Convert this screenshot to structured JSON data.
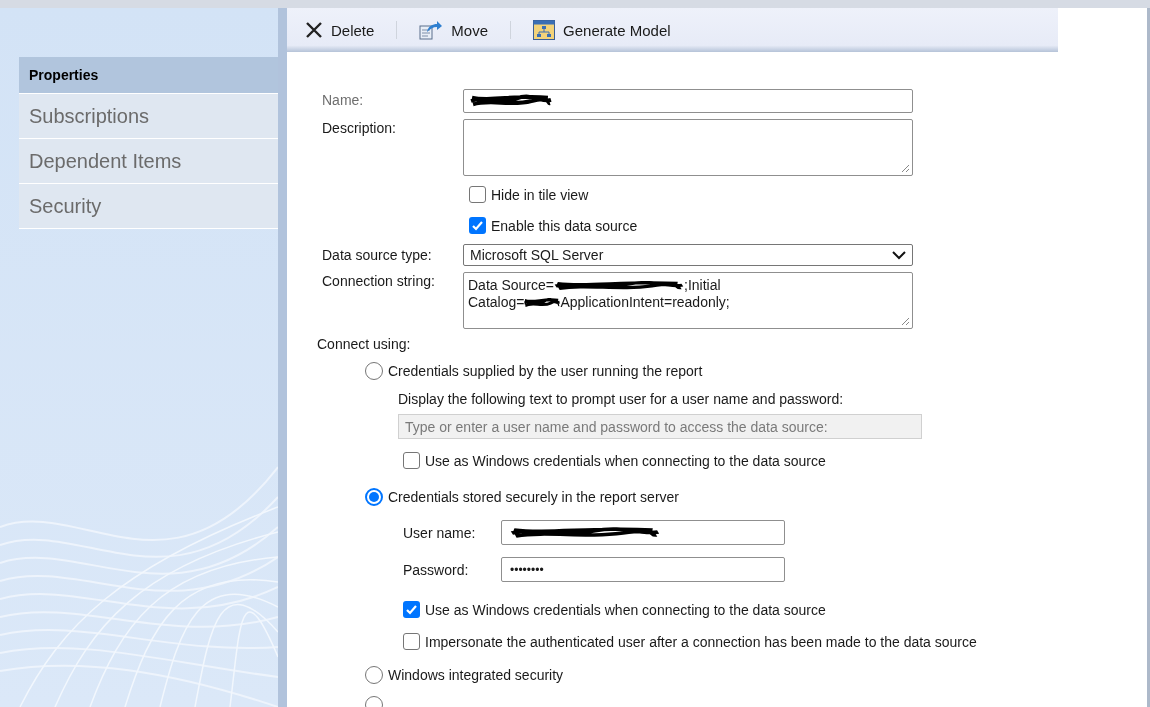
{
  "toolbar": {
    "buttons": [
      {
        "label": "Delete",
        "kind": "delete"
      },
      {
        "label": "Move",
        "kind": "move"
      },
      {
        "label": "Generate Model",
        "kind": "model"
      }
    ]
  },
  "sidebar": {
    "items": [
      {
        "label": "Properties",
        "selected": true
      },
      {
        "label": "Subscriptions",
        "selected": false
      },
      {
        "label": "Dependent Items",
        "selected": false
      },
      {
        "label": "Security",
        "selected": false
      }
    ]
  },
  "form": {
    "name": {
      "label": "Name:",
      "redacted": true
    },
    "description": {
      "label": "Description:"
    },
    "options": [
      {
        "label": "Hide in tile view",
        "checked": false
      },
      {
        "label": "Enable this data source",
        "checked": true
      }
    ],
    "data_source_type": {
      "label": "Data source type:",
      "value": "Microsoft SQL Server"
    },
    "connection_string": {
      "label": "Connection string:",
      "segments": [
        {
          "kind": "text",
          "text": "Data Source="
        },
        {
          "kind": "redacted"
        },
        {
          "kind": "text",
          "text": ";Initial Catalog="
        },
        {
          "kind": "redacted"
        },
        {
          "kind": "text",
          "text": "ApplicationIntent=readonly;"
        }
      ]
    },
    "connect_using": {
      "label": "Connect using:",
      "choices": [
        {
          "label": "Credentials supplied by the user running the report",
          "selected": false,
          "prompt_label": "Display the following text to prompt user for a user name and password:",
          "prompt_field": {
            "value": "Type or enter a user name and password to access the data source:",
            "disabled": true
          },
          "checkboxes": [
            {
              "label": "Use as Windows credentials when connecting to the data source",
              "checked": false
            }
          ]
        },
        {
          "label": "Credentials stored securely in the report server",
          "selected": true,
          "fields": [
            {
              "label": "User name:",
              "redacted": true
            },
            {
              "label": "Password:",
              "value": "••••••••"
            }
          ],
          "checkboxes": [
            {
              "label": "Use as Windows credentials when connecting to the data source",
              "checked": true
            },
            {
              "label": "Impersonate the authenticated user after a connection has been made to the data source",
              "checked": false
            }
          ]
        },
        {
          "label": "Windows integrated security",
          "selected": false
        },
        {
          "selected": false
        }
      ]
    }
  }
}
